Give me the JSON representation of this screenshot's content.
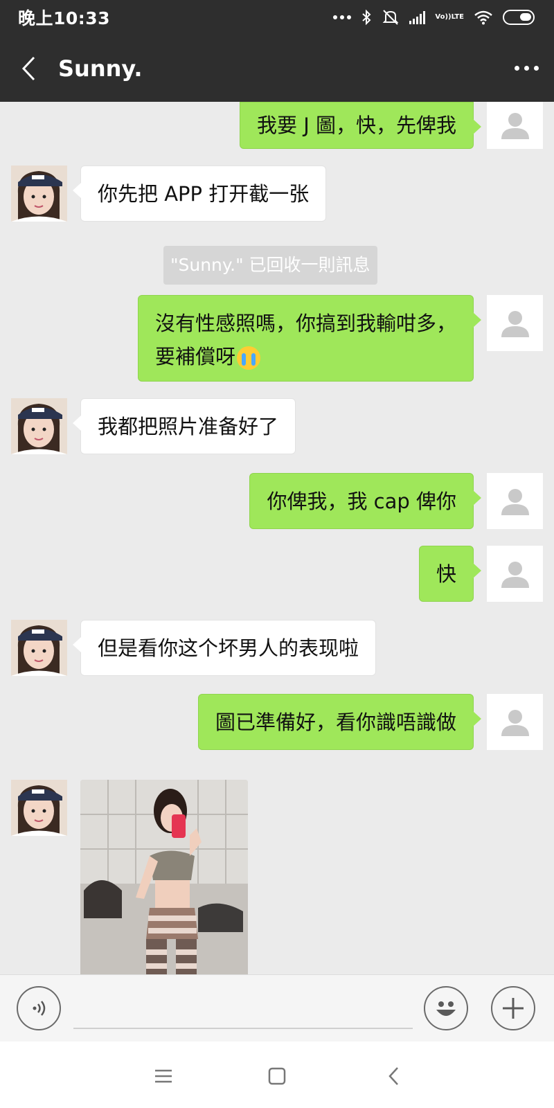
{
  "status_bar": {
    "time": "晚上10:33",
    "icons": [
      "more-dots-icon",
      "bluetooth-icon",
      "mute-icon",
      "signal-icon",
      "volte-icon",
      "wifi-icon",
      "battery-icon"
    ],
    "volte_label_top": "Vo))",
    "volte_label_bottom": "LTE"
  },
  "header": {
    "title": "Sunny.",
    "background": "#2e2e2e"
  },
  "chat": {
    "background": "#ebebeb",
    "my_bubble_color": "#9fe75a",
    "their_bubble_color": "#ffffff",
    "messages": [
      {
        "sender": "me",
        "text": "我要 J 圖，快，先俾我"
      },
      {
        "sender": "them",
        "text": "你先把 APP 打开截一张"
      },
      {
        "sender": "system",
        "text": "\"Sunny.\" 已回收一則訊息"
      },
      {
        "sender": "me",
        "line1": "沒有性感照嗎，你搞到我輸咁多，",
        "line2": "要補償呀",
        "emoji": "loudly-crying-face-emoji"
      },
      {
        "sender": "them",
        "text": "我都把照片准备好了"
      },
      {
        "sender": "me",
        "text": "你俾我，我 cap 俾你"
      },
      {
        "sender": "me",
        "text": "快"
      },
      {
        "sender": "them",
        "text": "但是看你这个坏男人的表现啦"
      },
      {
        "sender": "me",
        "text": "圖已準備好，看你識唔識做"
      },
      {
        "sender": "them",
        "type": "image"
      }
    ]
  },
  "input_bar": {
    "voice_icon": "voice-icon",
    "emoji_icon": "smiley-icon",
    "plus_icon": "plus-icon",
    "value": ""
  },
  "nav_bar": {
    "icons": [
      "menu-icon",
      "home-icon",
      "back-icon"
    ]
  }
}
